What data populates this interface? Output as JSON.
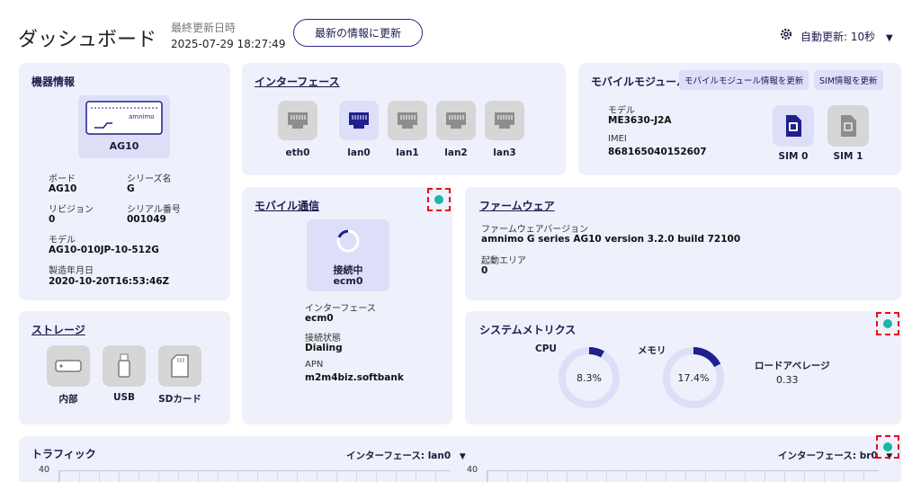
{
  "header": {
    "title": "ダッシュボード",
    "last_updated_label": "最終更新日時",
    "last_updated_value": "2025-07-29 18:27:49",
    "refresh_button": "最新の情報に更新",
    "auto_refresh": "自動更新: 10秒"
  },
  "device": {
    "title": "機器情報",
    "image_caption": "AG10",
    "logo_text": "amnimo",
    "board_label": "ボード",
    "board_value": "AG10",
    "series_label": "シリーズ名",
    "series_value": "G",
    "revision_label": "リビジョン",
    "revision_value": "0",
    "serial_label": "シリアル番号",
    "serial_value": "001049",
    "model_label": "モデル",
    "model_value": "AG10-010JP-10-512G",
    "mfg_label": "製造年月日",
    "mfg_value": "2020-10-20T16:53:46Z"
  },
  "interfaces": {
    "title": "インターフェース",
    "items": [
      {
        "name": "eth0",
        "active": false
      },
      {
        "name": "lan0",
        "active": true
      },
      {
        "name": "lan1",
        "active": false
      },
      {
        "name": "lan2",
        "active": false
      },
      {
        "name": "lan3",
        "active": false
      }
    ]
  },
  "mobile_module": {
    "title": "モバイルモジュール",
    "update_module_button": "モバイルモジュール情報を更新",
    "update_sim_button": "SIM情報を更新",
    "model_label": "モデル",
    "model_value": "ME3630-J2A",
    "imei_label": "IMEI",
    "imei_value": "868165040152607",
    "sim0": "SIM 0",
    "sim1": "SIM 1"
  },
  "mobile_comm": {
    "title": "モバイル通信",
    "status": "接続中",
    "status_iface": "ecm0",
    "iface_label": "インターフェース",
    "iface_value": "ecm0",
    "state_label": "接続状態",
    "state_value": "Dialing",
    "apn_label": "APN",
    "apn_value": "m2m4biz.softbank"
  },
  "firmware": {
    "title": "ファームウェア",
    "version_label": "ファームウェアバージョン",
    "version_value": "amnimo G series AG10 version 3.2.0 build 72100",
    "boot_label": "起動エリア",
    "boot_value": "0"
  },
  "storage": {
    "title": "ストレージ",
    "items": [
      "内部",
      "USB",
      "SDカード"
    ]
  },
  "metrics": {
    "title": "システムメトリクス",
    "cpu_label": "CPU",
    "cpu_value": "8.3%",
    "cpu_fraction": 0.083,
    "mem_label": "メモリ",
    "mem_value": "17.4%",
    "mem_fraction": 0.174,
    "load_label": "ロードアベレージ",
    "load_value": "0.33"
  },
  "traffic": {
    "title": "トラフィック",
    "left_iface": "インターフェース: lan0",
    "right_iface": "インターフェース: br0",
    "y_top_left": "40",
    "y_top_right": "40"
  },
  "colors": {
    "accent": "#1f1f8f",
    "card": "#eef0fb",
    "status_dot": "#19b7a4",
    "marker": "#e0101d"
  }
}
